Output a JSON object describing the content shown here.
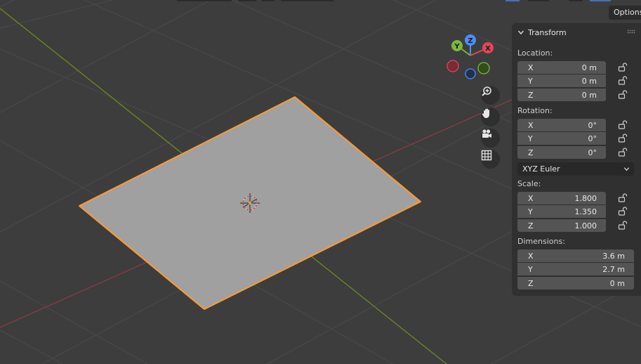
{
  "header": {
    "options_label": "Options"
  },
  "gizmo": {
    "axis_x": "X",
    "axis_y": "Y",
    "axis_z": "Z"
  },
  "nav_icons": [
    "zoom-icon",
    "hand-pan-icon",
    "camera-icon",
    "grid-ortho-icon"
  ],
  "colors": {
    "viewport_bg": "#3d3d3d",
    "grid_line": "#4a4a4a",
    "x_axis": "#8b3a44",
    "y_axis": "#6b8a23",
    "plane_fill": "#a0a0a0",
    "selection_outline": "#ff9a2e",
    "panel_bg": "#303030",
    "field_bg": "#545454"
  },
  "transform": {
    "title": "Transform",
    "location_label": "Location:",
    "location": [
      {
        "axis": "X",
        "value": "0 m"
      },
      {
        "axis": "Y",
        "value": "0 m"
      },
      {
        "axis": "Z",
        "value": "0 m"
      }
    ],
    "rotation_label": "Rotation:",
    "rotation": [
      {
        "axis": "X",
        "value": "0°"
      },
      {
        "axis": "Y",
        "value": "0°"
      },
      {
        "axis": "Z",
        "value": "0°"
      }
    ],
    "rotation_mode": "XYZ Euler",
    "scale_label": "Scale:",
    "scale": [
      {
        "axis": "X",
        "value": "1.800"
      },
      {
        "axis": "Y",
        "value": "1.350"
      },
      {
        "axis": "Z",
        "value": "1.000"
      }
    ],
    "dimensions_label": "Dimensions:",
    "dimensions": [
      {
        "axis": "X",
        "value": "3.6 m"
      },
      {
        "axis": "Y",
        "value": "2.7 m"
      },
      {
        "axis": "Z",
        "value": "0 m"
      }
    ]
  }
}
